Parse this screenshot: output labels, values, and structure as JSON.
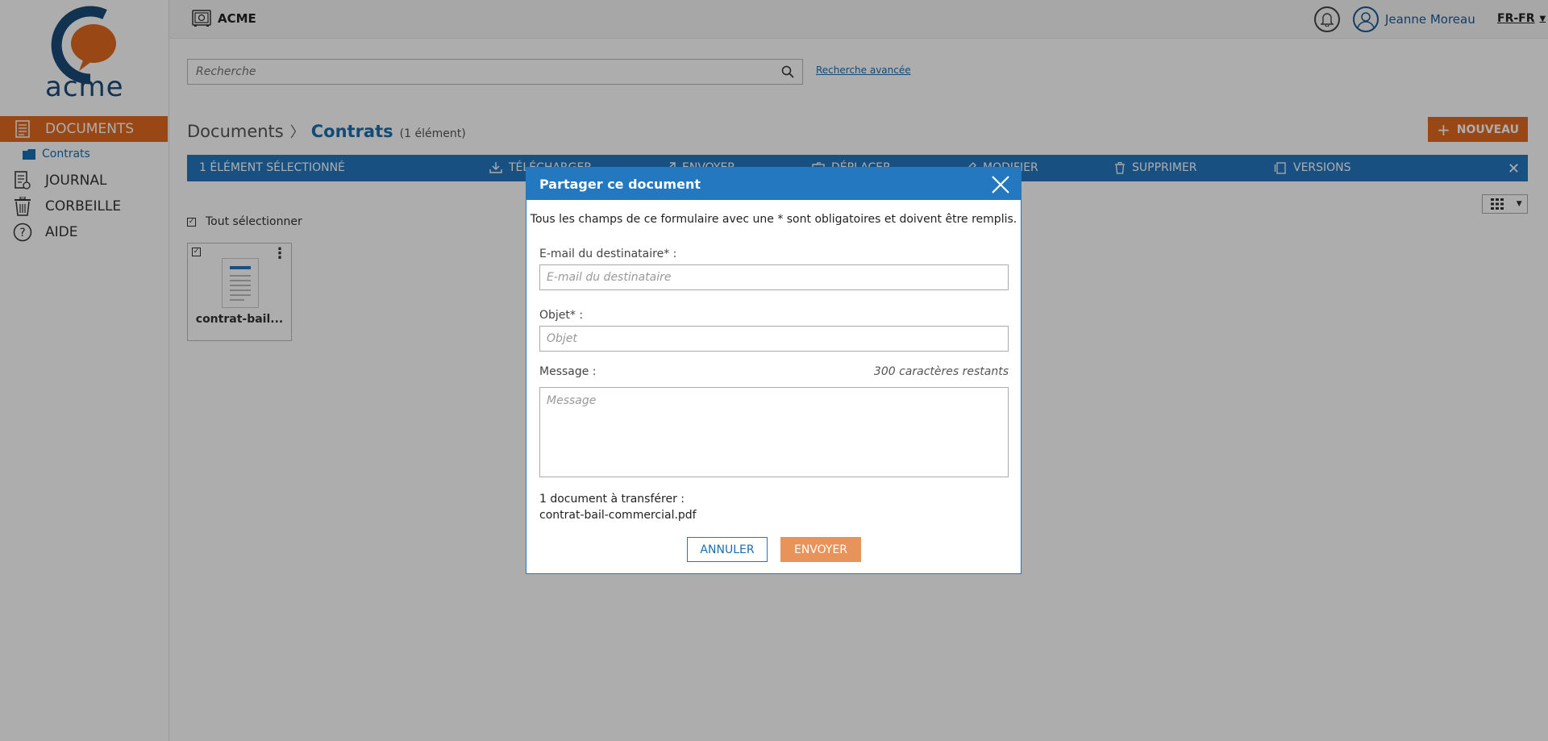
{
  "brand": {
    "logo_text": "acme",
    "app_name": "ACME"
  },
  "header": {
    "user_name": "Jeanne Moreau",
    "language": "FR-FR"
  },
  "search": {
    "placeholder": "Recherche",
    "advanced_label": "Recherche avancée"
  },
  "sidebar": {
    "items": [
      {
        "label": "DOCUMENTS",
        "icon": "document-list-icon",
        "active": true
      },
      {
        "label": "JOURNAL",
        "icon": "journal-icon"
      },
      {
        "label": "CORBEILLE",
        "icon": "trash-icon"
      },
      {
        "label": "AIDE",
        "icon": "help-icon"
      }
    ],
    "subitem": {
      "label": "Contrats",
      "icon": "folder-icon"
    }
  },
  "breadcrumb": {
    "root": "Documents",
    "current": "Contrats",
    "count": "(1 élément)"
  },
  "new_button": {
    "label": "NOUVEAU"
  },
  "selection_toolbar": {
    "selected_label": "1 ÉLÉMENT SÉLECTIONNÉ",
    "actions": [
      {
        "label": "TÉLÉCHARGER",
        "icon": "download-icon"
      },
      {
        "label": "ENVOYER",
        "icon": "send-icon"
      },
      {
        "label": "DÉPLACER",
        "icon": "move-icon"
      },
      {
        "label": "MODIFIER",
        "icon": "edit-icon"
      },
      {
        "label": "SUPPRIMER",
        "icon": "trash-icon"
      },
      {
        "label": "VERSIONS",
        "icon": "versions-icon"
      }
    ]
  },
  "list": {
    "select_all_label": "Tout sélectionner",
    "files": [
      {
        "name": "contrat-bail..."
      }
    ]
  },
  "modal": {
    "title": "Partager ce document",
    "info": "Tous les champs de ce formulaire avec une * sont obligatoires et doivent être remplis.",
    "email_label": "E-mail du destinataire* :",
    "email_placeholder": "E-mail du destinataire",
    "subject_label": "Objet* :",
    "subject_placeholder": "Objet",
    "message_label": "Message :",
    "message_placeholder": "Message",
    "chars_remaining": "300 caractères restants",
    "transfer_count": "1 document à transférer :",
    "transfer_file": "contrat-bail-commercial.pdf",
    "cancel_label": "ANNULER",
    "send_label": "ENVOYER"
  },
  "colors": {
    "primary_blue": "#2478bf",
    "accent_orange": "#e2691f",
    "send_orange": "#e8935a",
    "logo_navy": "#1a4a78"
  }
}
